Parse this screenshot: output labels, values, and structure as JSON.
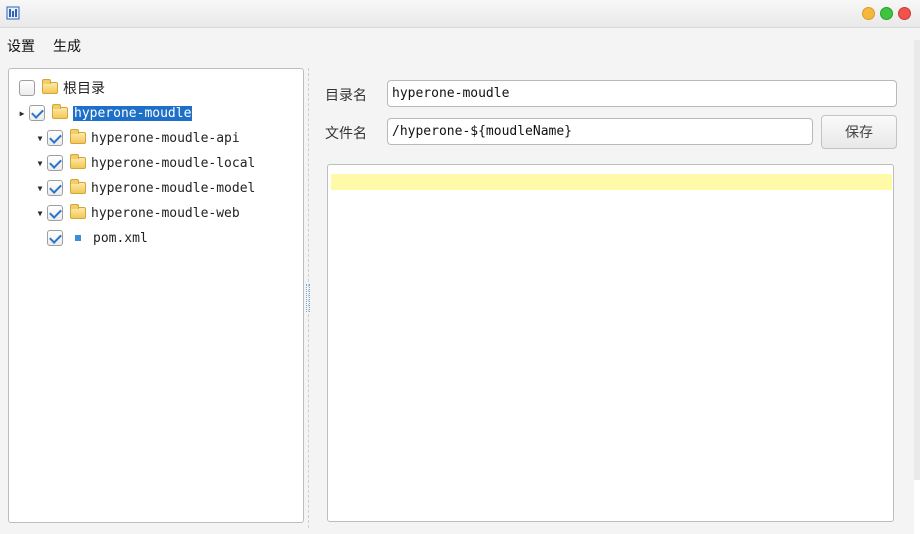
{
  "window": {
    "title": ""
  },
  "menubar": {
    "items": [
      "设置",
      "生成"
    ]
  },
  "tree": {
    "root": {
      "label": "根目录",
      "checked": false
    },
    "nodes": [
      {
        "label": "hyperone-moudle",
        "checked": true,
        "selected": true,
        "type": "folder",
        "expanded": false
      },
      {
        "label": "hyperone-moudle-api",
        "checked": true,
        "type": "folder",
        "expanded": true
      },
      {
        "label": "hyperone-moudle-local",
        "checked": true,
        "type": "folder",
        "expanded": true
      },
      {
        "label": "hyperone-moudle-model",
        "checked": true,
        "type": "folder",
        "expanded": true
      },
      {
        "label": "hyperone-moudle-web",
        "checked": true,
        "type": "folder",
        "expanded": true
      },
      {
        "label": "pom.xml",
        "checked": true,
        "type": "file"
      }
    ]
  },
  "form": {
    "dir_label": "目录名",
    "dir_value": "hyperone-moudle",
    "file_label": "文件名",
    "file_value": "/hyperone-${moudleName}",
    "save_label": "保存"
  },
  "editor": {
    "content": ""
  },
  "colors": {
    "selection": "#1e6fc8",
    "editor_line": "#fffaa8",
    "check": "#2b75c9"
  }
}
